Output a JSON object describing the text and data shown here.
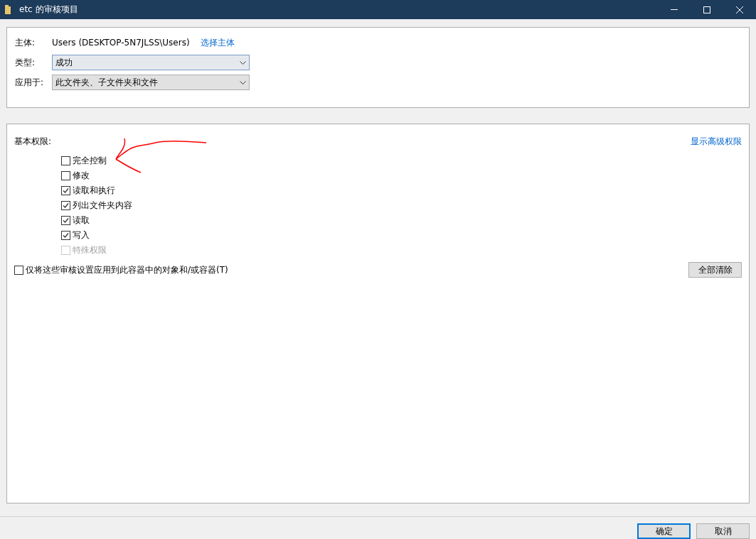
{
  "window": {
    "title": "etc 的审核项目"
  },
  "principal": {
    "label": "主体:",
    "value": "Users (DESKTOP-5N7JLSS\\Users)",
    "link": "选择主体"
  },
  "selects": [
    {
      "label": "类型:",
      "value": "成功",
      "focused": true
    },
    {
      "label": "应用于:",
      "value": "此文件夹、子文件夹和文件",
      "focused": false
    }
  ],
  "permissions": {
    "label": "基本权限:",
    "advanced_link": "显示高级权限",
    "items": [
      {
        "label": "完全控制",
        "checked": false,
        "disabled": false
      },
      {
        "label": "修改",
        "checked": false,
        "disabled": false
      },
      {
        "label": "读取和执行",
        "checked": true,
        "disabled": false
      },
      {
        "label": "列出文件夹内容",
        "checked": true,
        "disabled": false
      },
      {
        "label": "读取",
        "checked": true,
        "disabled": false
      },
      {
        "label": "写入",
        "checked": true,
        "disabled": false
      },
      {
        "label": "特殊权限",
        "checked": false,
        "disabled": true
      }
    ]
  },
  "apply_only": {
    "label": "仅将这些审核设置应用到此容器中的对象和/或容器(T)",
    "checked": false
  },
  "clear_button": "全部清除",
  "annotation": {
    "kind": "arrow"
  },
  "buttons": [
    {
      "label": "确定",
      "default": true
    },
    {
      "label": "取消",
      "default": false
    }
  ]
}
